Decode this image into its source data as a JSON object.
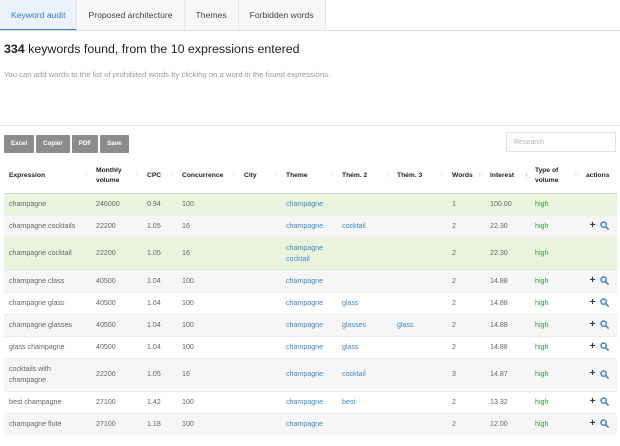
{
  "tabs": [
    {
      "label": "Keyword audit",
      "active": true
    },
    {
      "label": "Proposed architecture",
      "active": false
    },
    {
      "label": "Themes",
      "active": false
    },
    {
      "label": "Forbidden words",
      "active": false
    }
  ],
  "summary": {
    "count": "334",
    "text": " keywords found, from the 10 expressions entered"
  },
  "hint": "You can add words to the list of prohibited words by clicking on a word in the found expressions.",
  "toolbar": {
    "excel": "Excel",
    "copier": "Copier",
    "pdf": "PDF",
    "save": "Save"
  },
  "search": {
    "placeholder": "Research",
    "value": ""
  },
  "columns": [
    {
      "label": "Expression",
      "sort": true
    },
    {
      "label": "Monthly volume",
      "sort": true
    },
    {
      "label": "CPC",
      "sort": true
    },
    {
      "label": "Concurrence",
      "sort": true
    },
    {
      "label": "City",
      "sort": true
    },
    {
      "label": "Theme",
      "sort": true
    },
    {
      "label": "Thém. 2",
      "sort": true
    },
    {
      "label": "Thém. 3",
      "sort": true
    },
    {
      "label": "Words",
      "sort": true
    },
    {
      "label": "Interest",
      "sort": true,
      "active": true
    },
    {
      "label": "Type of volume",
      "sort": true
    },
    {
      "label": "actions",
      "sort": false
    }
  ],
  "rows": [
    {
      "expression": "champagne",
      "volume": "246000",
      "cpc": "0.94",
      "concurrence": "100",
      "city": "",
      "theme": "champagne",
      "them2": "",
      "them3": "",
      "words": "1",
      "interest": "100.00",
      "type": "high",
      "green": true,
      "actions": false
    },
    {
      "expression": "champagne cocktails",
      "volume": "22200",
      "cpc": "1.05",
      "concurrence": "16",
      "city": "",
      "theme": "champagne",
      "them2": "cocktail",
      "them3": "",
      "words": "2",
      "interest": "22.30",
      "type": "high",
      "green": false,
      "actions": true
    },
    {
      "expression": "champagne cocktail",
      "volume": "22200",
      "cpc": "1.05",
      "concurrence": "16",
      "city": "",
      "theme": "champagne cocktail",
      "them2": "",
      "them3": "",
      "words": "2",
      "interest": "22.30",
      "type": "high",
      "green": true,
      "actions": false
    },
    {
      "expression": "champagne class",
      "volume": "40500",
      "cpc": "1.04",
      "concurrence": "100",
      "city": "",
      "theme": "champagne",
      "them2": "",
      "them3": "",
      "words": "2",
      "interest": "14.88",
      "type": "high",
      "green": false,
      "actions": true
    },
    {
      "expression": "champagne glass",
      "volume": "40500",
      "cpc": "1.04",
      "concurrence": "100",
      "city": "",
      "theme": "champagne",
      "them2": "glass",
      "them3": "",
      "words": "2",
      "interest": "14.88",
      "type": "high",
      "green": false,
      "actions": true
    },
    {
      "expression": "champagne glasses",
      "volume": "40500",
      "cpc": "1.04",
      "concurrence": "100",
      "city": "",
      "theme": "champagne",
      "them2": "glasses",
      "them3": "glass",
      "words": "2",
      "interest": "14.88",
      "type": "high",
      "green": false,
      "actions": true
    },
    {
      "expression": "glass champagne",
      "volume": "40500",
      "cpc": "1.04",
      "concurrence": "100",
      "city": "",
      "theme": "champagne",
      "them2": "glass",
      "them3": "",
      "words": "2",
      "interest": "14.88",
      "type": "high",
      "green": false,
      "actions": true
    },
    {
      "expression": "cocktails with champagne",
      "volume": "22200",
      "cpc": "1.05",
      "concurrence": "16",
      "city": "",
      "theme": "champagne",
      "them2": "cocktail",
      "them3": "",
      "words": "3",
      "interest": "14.87",
      "type": "high",
      "green": false,
      "actions": true
    },
    {
      "expression": "best champagne",
      "volume": "27100",
      "cpc": "1.42",
      "concurrence": "100",
      "city": "",
      "theme": "champagne",
      "them2": "best",
      "them3": "",
      "words": "2",
      "interest": "13.32",
      "type": "high",
      "green": false,
      "actions": true
    },
    {
      "expression": "champagne flute",
      "volume": "27100",
      "cpc": "1.18",
      "concurrence": "100",
      "city": "",
      "theme": "champagne",
      "them2": "",
      "them3": "",
      "words": "2",
      "interest": "12.00",
      "type": "high",
      "green": false,
      "actions": true
    }
  ],
  "icons": {
    "plus": "plus-icon",
    "search": "magnifier-icon"
  },
  "colors": {
    "link": "#3d86c8",
    "type_high": "#2e9d3b",
    "highlight_row": "#eaf4dc",
    "active_tab": "#3a7bd5",
    "action_icon": "#1c3f73"
  }
}
